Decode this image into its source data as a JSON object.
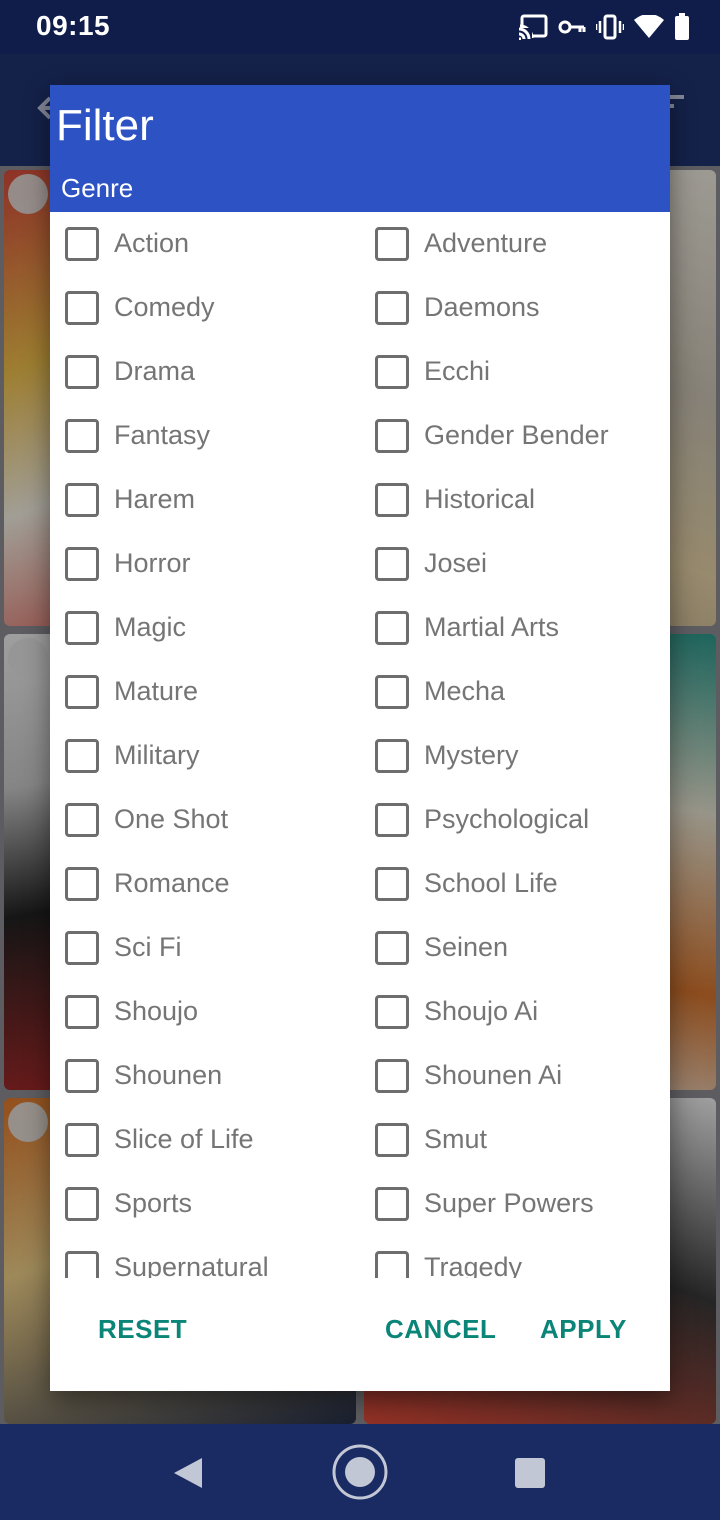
{
  "status_bar": {
    "time": "09:15",
    "icons": [
      "cast-icon",
      "vpn-key-icon",
      "vibrate-icon",
      "wifi-icon",
      "battery-icon"
    ]
  },
  "dialog": {
    "title": "Filter",
    "section": "Genre",
    "genres": [
      {
        "label": "Action",
        "checked": false
      },
      {
        "label": "Adventure",
        "checked": false
      },
      {
        "label": "Comedy",
        "checked": false
      },
      {
        "label": "Daemons",
        "checked": false
      },
      {
        "label": "Drama",
        "checked": false
      },
      {
        "label": "Ecchi",
        "checked": false
      },
      {
        "label": "Fantasy",
        "checked": false
      },
      {
        "label": "Gender Bender",
        "checked": false
      },
      {
        "label": "Harem",
        "checked": false
      },
      {
        "label": "Historical",
        "checked": false
      },
      {
        "label": "Horror",
        "checked": false
      },
      {
        "label": "Josei",
        "checked": false
      },
      {
        "label": "Magic",
        "checked": false
      },
      {
        "label": "Martial Arts",
        "checked": false
      },
      {
        "label": "Mature",
        "checked": false
      },
      {
        "label": "Mecha",
        "checked": false
      },
      {
        "label": "Military",
        "checked": false
      },
      {
        "label": "Mystery",
        "checked": false
      },
      {
        "label": "One Shot",
        "checked": false
      },
      {
        "label": "Psychological",
        "checked": false
      },
      {
        "label": "Romance",
        "checked": false
      },
      {
        "label": "School Life",
        "checked": false
      },
      {
        "label": "Sci Fi",
        "checked": false
      },
      {
        "label": "Seinen",
        "checked": false
      },
      {
        "label": "Shoujo",
        "checked": false
      },
      {
        "label": "Shoujo Ai",
        "checked": false
      },
      {
        "label": "Shounen",
        "checked": false
      },
      {
        "label": "Shounen Ai",
        "checked": false
      },
      {
        "label": "Slice of Life",
        "checked": false
      },
      {
        "label": "Smut",
        "checked": false
      },
      {
        "label": "Sports",
        "checked": false
      },
      {
        "label": "Super Powers",
        "checked": false
      },
      {
        "label": "Supernatural",
        "checked": false
      },
      {
        "label": "Tragedy",
        "checked": false
      }
    ],
    "actions": {
      "reset": "RESET",
      "cancel": "CANCEL",
      "apply": "APPLY"
    }
  },
  "colors": {
    "header": "#2c52c3",
    "accent": "#0b8577",
    "label": "#757575",
    "checkbox_border": "#6d6d6d"
  },
  "navigation": {
    "buttons": [
      "back-icon",
      "home-icon",
      "recents-icon"
    ]
  }
}
